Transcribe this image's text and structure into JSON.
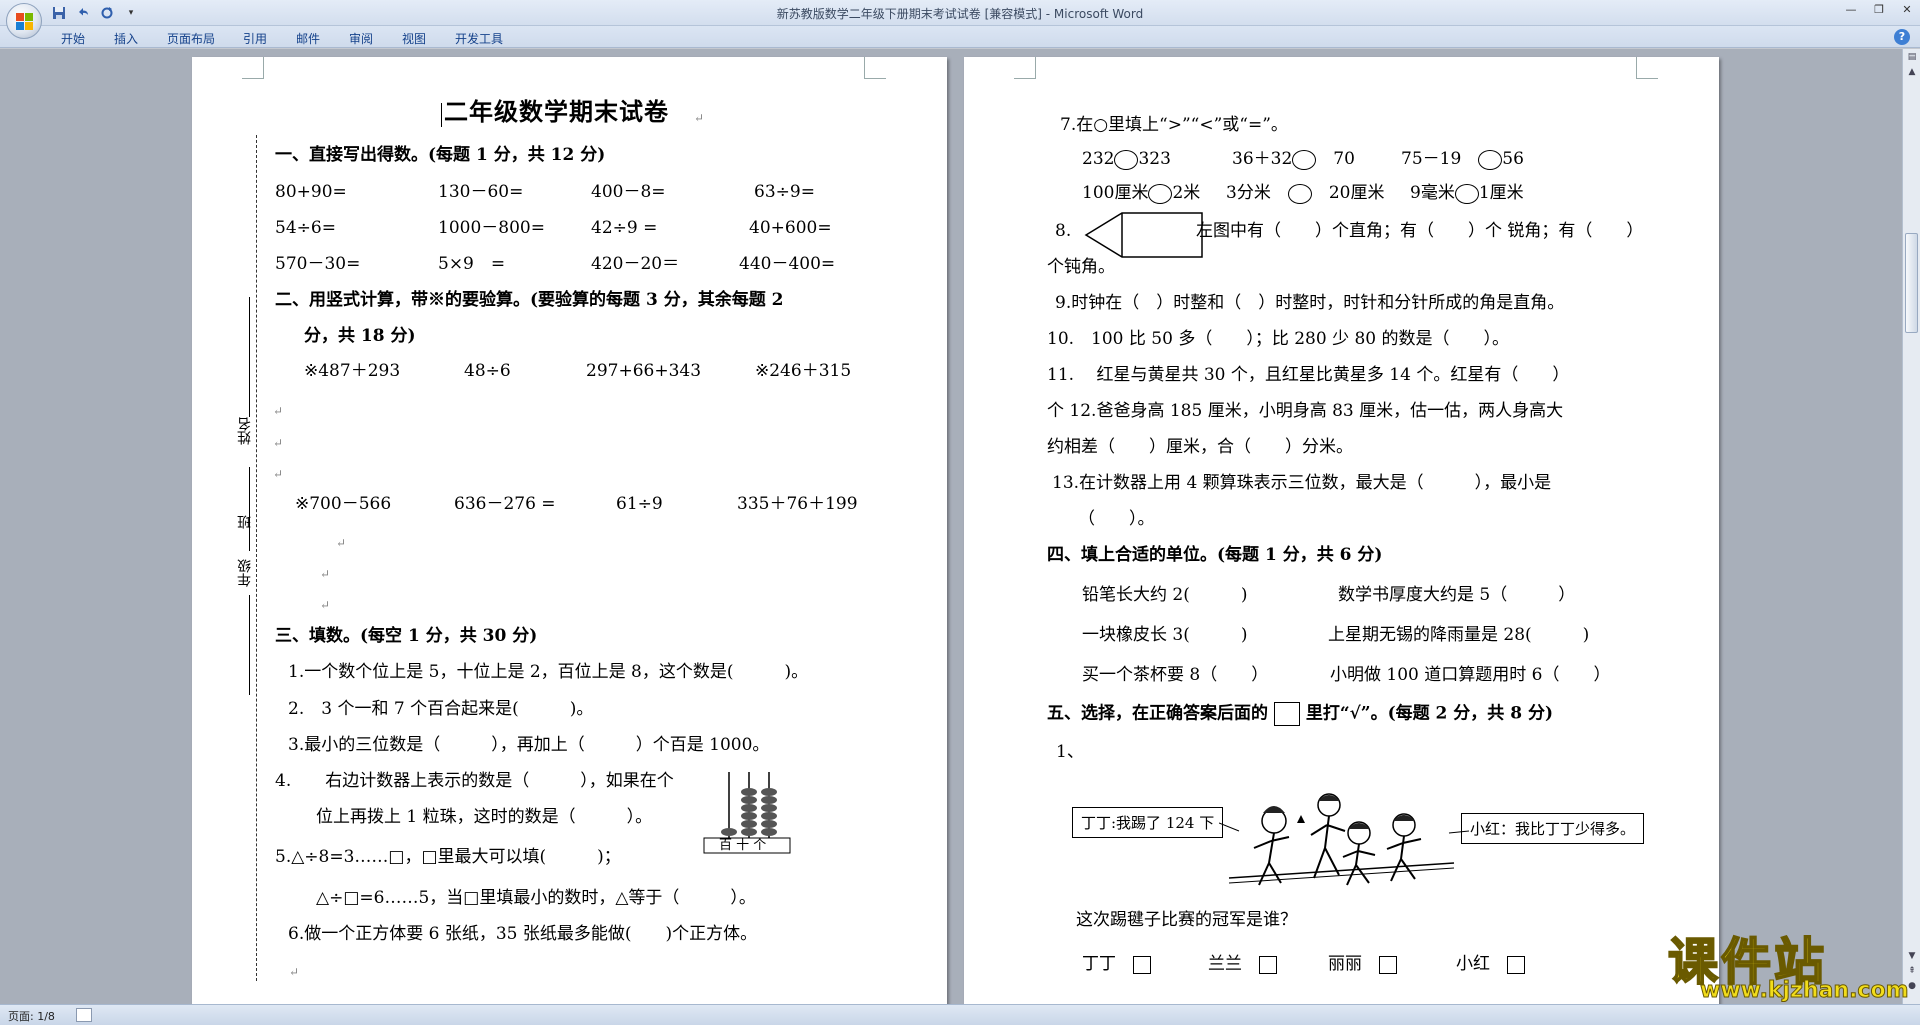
{
  "window": {
    "title": "新苏教版数学二年级下册期末考试试卷 [兼容模式] - Microsoft Word",
    "tabs": [
      "开始",
      "插入",
      "页面布局",
      "引用",
      "邮件",
      "审阅",
      "视图",
      "开发工具"
    ]
  },
  "status": {
    "page": "页面: 1/8"
  },
  "watermark": {
    "main": "课件站",
    "url": "www.kjzhan.com"
  },
  "left": {
    "title": "二年级数学期末试卷",
    "sec1": "一、直接写出得数。(每题 1 分，共 12 分)",
    "r1": [
      "80+90=",
      "130－60=",
      "400－8=",
      "63÷9="
    ],
    "r2": [
      "54÷6=",
      "1000－800=",
      "42÷9 =",
      "40+600="
    ],
    "r3": [
      "570－30=",
      "5×9　=",
      "420－20＝",
      "440－400="
    ],
    "sec2a": "二、用竖式计算，带※的要验算。(要验算的每题 3 分，其余每题 2",
    "sec2b": "分，共 18 分)",
    "v1": [
      "※487＋293",
      "48÷6",
      "297+66+343",
      "※246＋315"
    ],
    "v2": [
      "※700－566",
      "636－276 =",
      "61÷9",
      "335＋76＋199"
    ],
    "sec3": "三、填数。(每空 1 分，共 30 分)",
    "q1": "1.一个数个位上是 5，十位上是 2，百位上是 8，这个数是(　　　)。",
    "q2": "2.　3 个一和 7 个百合起来是(　　　)。",
    "q3": "3.最小的三位数是（　　　），再加上（　　　）个百是 1000。",
    "q4a": "4.　　右边计数器上表示的数是（　　　），如果在个",
    "q4b": "位上再拨上 1 粒珠，这时的数是（　　　）。",
    "abacus_label": "百 十 个",
    "q5a": "5.△÷8=3……□，□里最大可以填(　　　)；",
    "q5b": "△÷□=6……5，当□里填最小的数时，△等于（　　　）。",
    "q6": "6.做一个正方体要 6 张纸，35 张纸最多能做(　　)个正方体。",
    "margin_name": "姓名",
    "margin_class": "班",
    "margin_grade": "年级"
  },
  "right": {
    "q7": "7.在○里填上“>”“<”或“=”。",
    "c1": [
      "232",
      "323",
      "36＋32",
      "70",
      "75－19",
      "56"
    ],
    "c2": [
      "100厘米",
      "2米",
      "3分米",
      "20厘米",
      "9毫米",
      "1厘米"
    ],
    "q8": "左图中有（　　）个直角；有（　　）个 锐角；有（　　）",
    "q8_num": "8.",
    "q8b": "个钝角。",
    "q9": "9.时钟在（　）时整和（　）时整时，时针和分针所成的角是直角。",
    "q10": "10.　100 比 50 多（　　）；比 280 少 80 的数是（　　）。",
    "q11": "11.　 红星与黄星共 30 个，且红星比黄星多 14 个。红星有（　　）",
    "q12a": "个 12.爸爸身高 185 厘米，小明身高 83 厘米，估一估，两人身高大",
    "q12b": "约相差（　　）厘米，合（　　）分米。",
    "q13a": "13.在计数器上用 4 颗算珠表示三位数，最大是（　　　），最小是",
    "q13b": "（　　）。",
    "sec4": "四、填上合适的单位。(每题 1 分，共 6 分)",
    "u1a": "铅笔长大约 2(　　　)",
    "u1b": "数学书厚度大约是 5（　　　）",
    "u2a": "一块橡皮长 3(　　　)",
    "u2b": "上星期无锡的降雨量是 28(　　　)",
    "u3a": "买一个茶杯要 8（　　）",
    "u3b": "小明做 100 道口算题用时 6（　　）",
    "sec5a": "五、选择，在正确答案后面的",
    "sec5b": "里打“√”。(每题 2 分，共 8 分)",
    "s1": "1、",
    "bubble_left": "丁丁:我踢了 124 下",
    "bubble_right": "小红：我比丁丁少得多。",
    "question": "这次踢毽子比赛的冠军是谁？",
    "choices": [
      "丁丁",
      "兰兰",
      "丽丽",
      "小红"
    ]
  }
}
